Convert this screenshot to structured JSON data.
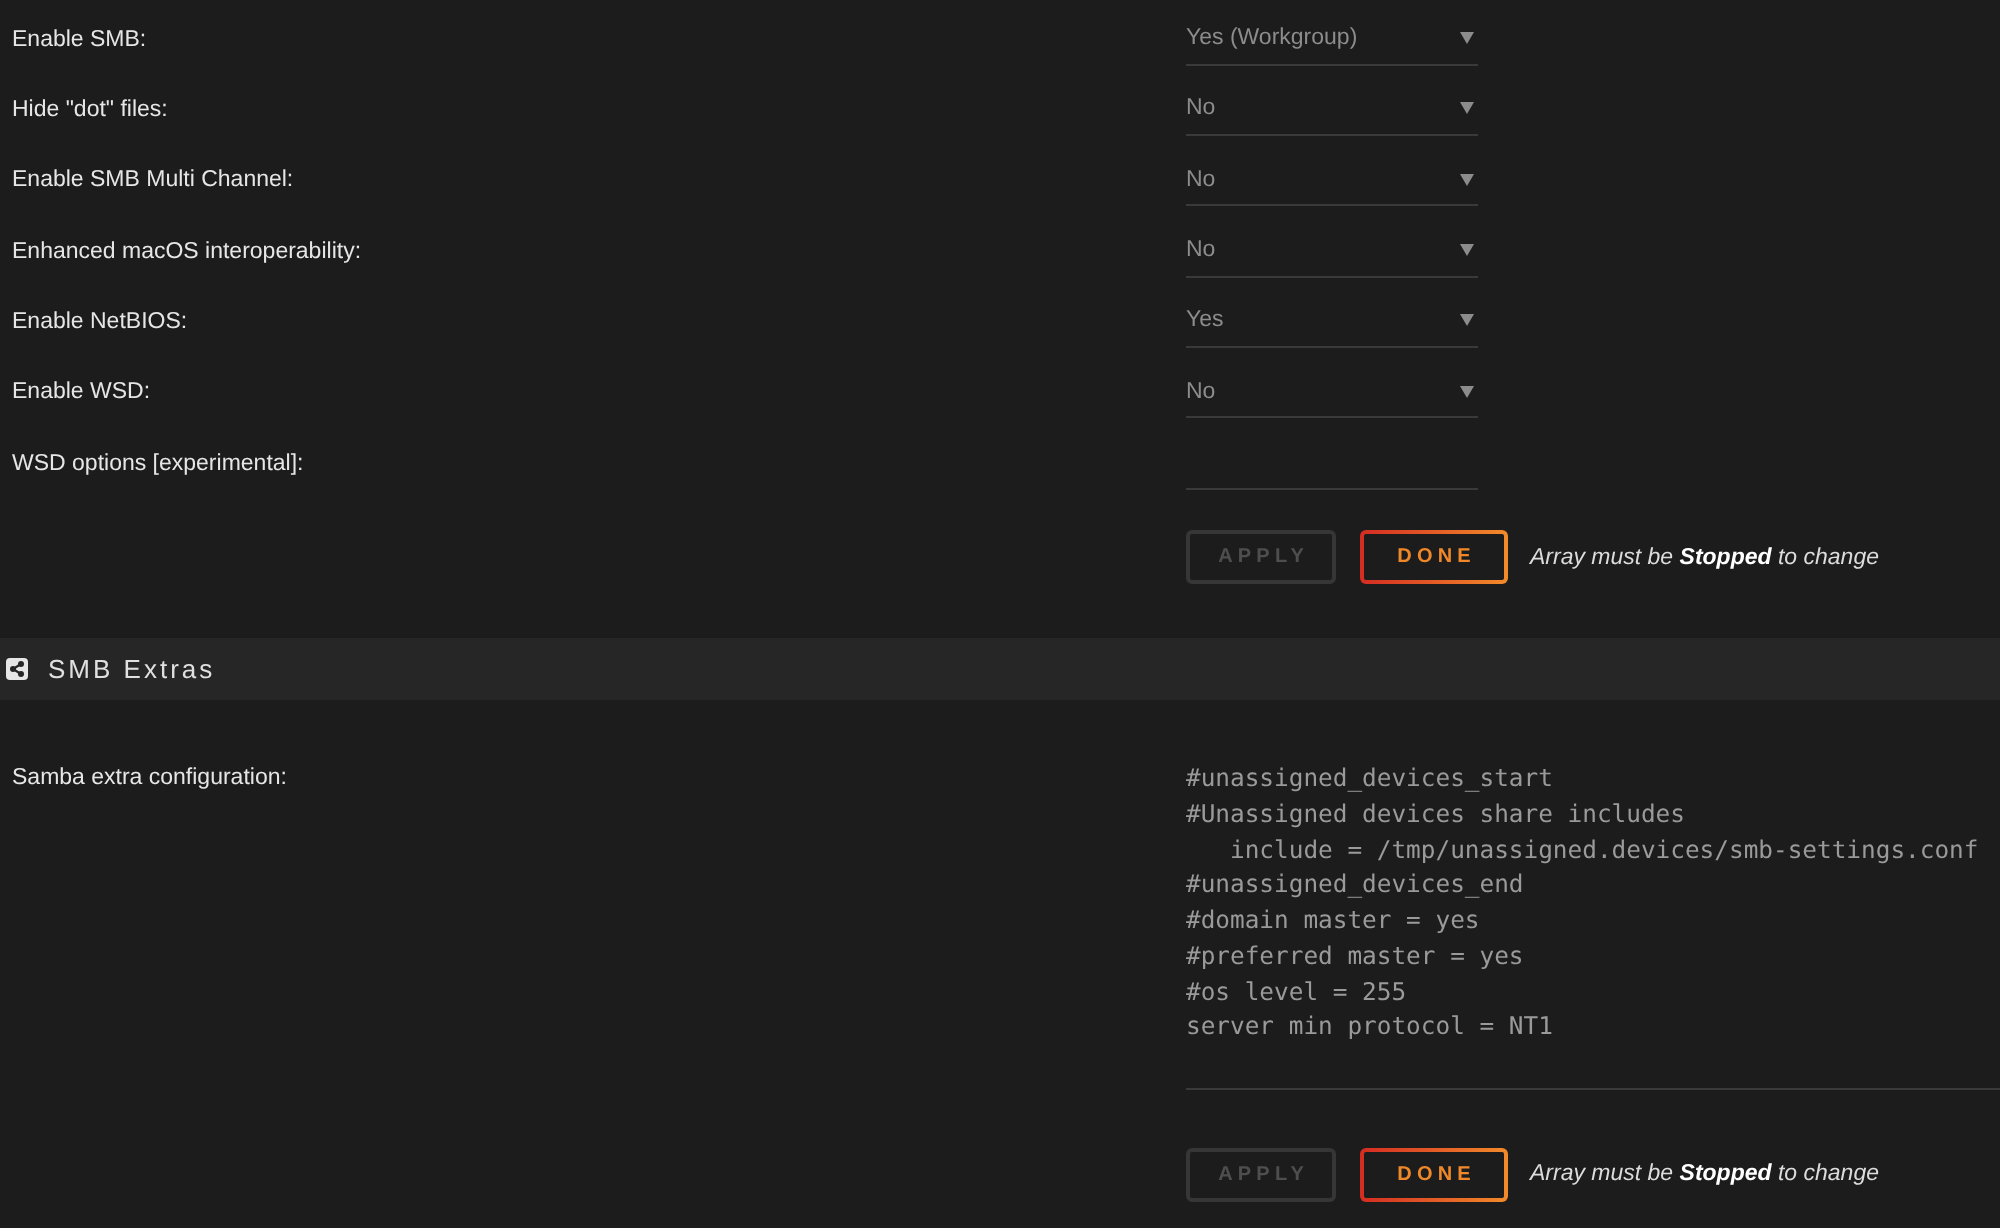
{
  "settings": {
    "rows": [
      {
        "label": "Enable SMB:",
        "kind": "select",
        "value": "Yes (Workgroup)"
      },
      {
        "label": "Hide \"dot\" files:",
        "kind": "select",
        "value": "No"
      },
      {
        "label": "Enable SMB Multi Channel:",
        "kind": "select",
        "value": "No"
      },
      {
        "label": "Enhanced macOS interoperability:",
        "kind": "select",
        "value": "No"
      },
      {
        "label": "Enable NetBIOS:",
        "kind": "select",
        "value": "Yes"
      },
      {
        "label": "Enable WSD:",
        "kind": "select",
        "value": "No"
      },
      {
        "label": "WSD options [experimental]:",
        "kind": "text"
      }
    ],
    "buttons": [
      {
        "label": "APPLY",
        "disabled": true
      },
      {
        "label": "DONE",
        "disabled": false
      }
    ],
    "note": "Array must be **Stopped** to change"
  },
  "smb_extras": {
    "title": "SMB Extras",
    "label": "Samba extra configuration:",
    "config": "#unassigned_devices_start\n#Unassigned devices share includes\n   include = /tmp/unassigned.devices/smb-settings.conf\n#unassigned_devices_end\n#domain master = yes\n#preferred master = yes\n#os level = 255\nserver min protocol = NT1",
    "buttons": [
      {
        "label": "APPLY",
        "disabled": true
      },
      {
        "label": "DONE",
        "disabled": false
      }
    ],
    "note": "Array must be **Stopped** to change"
  }
}
